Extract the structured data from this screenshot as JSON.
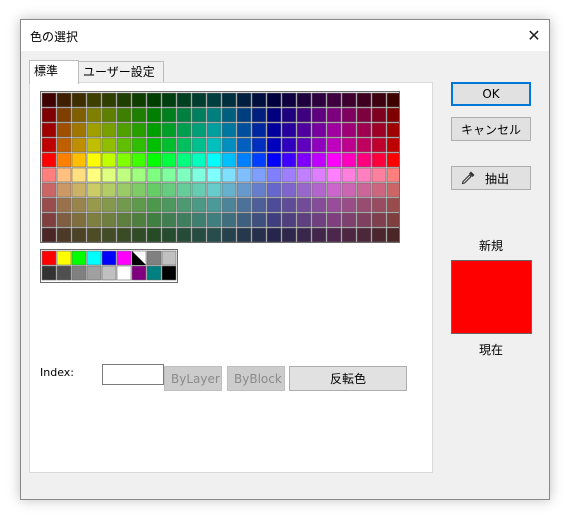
{
  "dialog": {
    "title": "色の選択",
    "close_glyph": "✕"
  },
  "tabs": [
    {
      "label": "標準",
      "active": true
    },
    {
      "label": "ユーザー設定",
      "active": false
    }
  ],
  "index": {
    "label": "Index:",
    "value": ""
  },
  "buttons": {
    "bylayer": "ByLayer",
    "byblock": "ByBlock",
    "invert": "反転色",
    "ok": "OK",
    "cancel": "キャンセル",
    "pick": "抽出"
  },
  "preview": {
    "new_label": "新規",
    "current_label": "現在",
    "new_color": "#ff0000",
    "current_color": "#ff0000"
  },
  "palette": {
    "rows": [
      [
        "#3f0000",
        "#3f1f00",
        "#3f2f00",
        "#3f3f00",
        "#2f3f00",
        "#1f3f00",
        "#0f3f00",
        "#003f00",
        "#003f0f",
        "#003f1f",
        "#003f2f",
        "#003f3f",
        "#002f3f",
        "#001f3f",
        "#000f3f",
        "#00003f",
        "#0f003f",
        "#1f003f",
        "#2f003f",
        "#3f003f",
        "#3f002f",
        "#3f001f",
        "#3f000f",
        "#3f0000"
      ],
      [
        "#7f0000",
        "#7f3f00",
        "#7f5f00",
        "#7f7f00",
        "#5f7f00",
        "#3f7f00",
        "#1f7f00",
        "#007f00",
        "#007f1f",
        "#007f3f",
        "#007f5f",
        "#007f7f",
        "#005f7f",
        "#003f7f",
        "#001f7f",
        "#00007f",
        "#1f007f",
        "#3f007f",
        "#5f007f",
        "#7f007f",
        "#7f005f",
        "#7f003f",
        "#7f001f",
        "#7f0000"
      ],
      [
        "#9f0000",
        "#9f4f00",
        "#9f7700",
        "#9f9f00",
        "#779f00",
        "#4f9f00",
        "#279f00",
        "#009f00",
        "#009f27",
        "#009f4f",
        "#009f77",
        "#009f9f",
        "#00779f",
        "#004f9f",
        "#00279f",
        "#00009f",
        "#27009f",
        "#4f009f",
        "#77009f",
        "#9f009f",
        "#9f0077",
        "#9f004f",
        "#9f0027",
        "#9f0000"
      ],
      [
        "#bf0000",
        "#bf5f00",
        "#bf8f00",
        "#bfbf00",
        "#8fbf00",
        "#5fbf00",
        "#2fbf00",
        "#00bf00",
        "#00bf2f",
        "#00bf5f",
        "#00bf8f",
        "#00bfbf",
        "#008fbf",
        "#005fbf",
        "#002fbf",
        "#0000bf",
        "#2f00bf",
        "#5f00bf",
        "#8f00bf",
        "#bf00bf",
        "#bf008f",
        "#bf005f",
        "#bf002f",
        "#bf0000"
      ],
      [
        "#ff0000",
        "#ff7f00",
        "#ffbf00",
        "#ffff00",
        "#bfff00",
        "#7fff00",
        "#3fff00",
        "#00ff00",
        "#00ff3f",
        "#00ff7f",
        "#00ffbf",
        "#00ffff",
        "#00bfff",
        "#007fff",
        "#003fff",
        "#0000ff",
        "#3f00ff",
        "#7f00ff",
        "#bf00ff",
        "#ff00ff",
        "#ff00bf",
        "#ff007f",
        "#ff003f",
        "#ff0000"
      ],
      [
        "#ff7f7f",
        "#ffbf7f",
        "#ffdf7f",
        "#ffff7f",
        "#dfff7f",
        "#bfff7f",
        "#9fff7f",
        "#7fff7f",
        "#7fff9f",
        "#7fffbf",
        "#7fffdf",
        "#7fffff",
        "#7fdfff",
        "#7fbfff",
        "#7f9fff",
        "#7f7fff",
        "#9f7fff",
        "#bf7fff",
        "#df7fff",
        "#ff7fff",
        "#ff7fdf",
        "#ff7fbf",
        "#ff7f9f",
        "#ff7f7f"
      ],
      [
        "#cc6666",
        "#cc9966",
        "#ccb266",
        "#cccc66",
        "#b2cc66",
        "#99cc66",
        "#7fcc66",
        "#66cc66",
        "#66cc7f",
        "#66cc99",
        "#66ccb2",
        "#66cccc",
        "#66b2cc",
        "#6699cc",
        "#667fcc",
        "#6666cc",
        "#7f66cc",
        "#9966cc",
        "#b266cc",
        "#cc66cc",
        "#cc66b2",
        "#cc6699",
        "#cc667f",
        "#cc6666"
      ],
      [
        "#994c4c",
        "#99724c",
        "#99854c",
        "#99994c",
        "#85994c",
        "#72994c",
        "#5f994c",
        "#4c994c",
        "#4c995f",
        "#4c9972",
        "#4c9985",
        "#4c9999",
        "#4c8599",
        "#4c7299",
        "#4c5f99",
        "#4c4c99",
        "#5f4c99",
        "#724c99",
        "#854c99",
        "#994c99",
        "#994c85",
        "#994c72",
        "#994c5f",
        "#994c4c"
      ],
      [
        "#7f3f3f",
        "#7f5f3f",
        "#7f6f3f",
        "#7f7f3f",
        "#6f7f3f",
        "#5f7f3f",
        "#4f7f3f",
        "#3f7f3f",
        "#3f7f4f",
        "#3f7f5f",
        "#3f7f6f",
        "#3f7f7f",
        "#3f6f7f",
        "#3f5f7f",
        "#3f4f7f",
        "#3f3f7f",
        "#4f3f7f",
        "#5f3f7f",
        "#6f3f7f",
        "#7f3f7f",
        "#7f3f6f",
        "#7f3f5f",
        "#7f3f4f",
        "#7f3f3f"
      ],
      [
        "#4c2626",
        "#4c3926",
        "#4c4226",
        "#4c4c26",
        "#424c26",
        "#394c26",
        "#2f4c26",
        "#264c26",
        "#264c2f",
        "#264c39",
        "#264c42",
        "#264c4c",
        "#26424c",
        "#26394c",
        "#262f4c",
        "#26264c",
        "#2f264c",
        "#39264c",
        "#42264c",
        "#4c264c",
        "#4c2642",
        "#4c2639",
        "#4c262f",
        "#4c2626"
      ]
    ],
    "standard": [
      [
        "#ff0000",
        "#ffff00",
        "#00ff00",
        "#00ffff",
        "#0000ff",
        "#ff00ff",
        "black-white",
        "#808080",
        "#c0c0c0"
      ],
      [
        "#333333",
        "#505050",
        "#808080",
        "#a0a0a0",
        "#c0c0c0",
        "#ffffff",
        "#800080",
        "#008080",
        "#000000"
      ]
    ]
  }
}
